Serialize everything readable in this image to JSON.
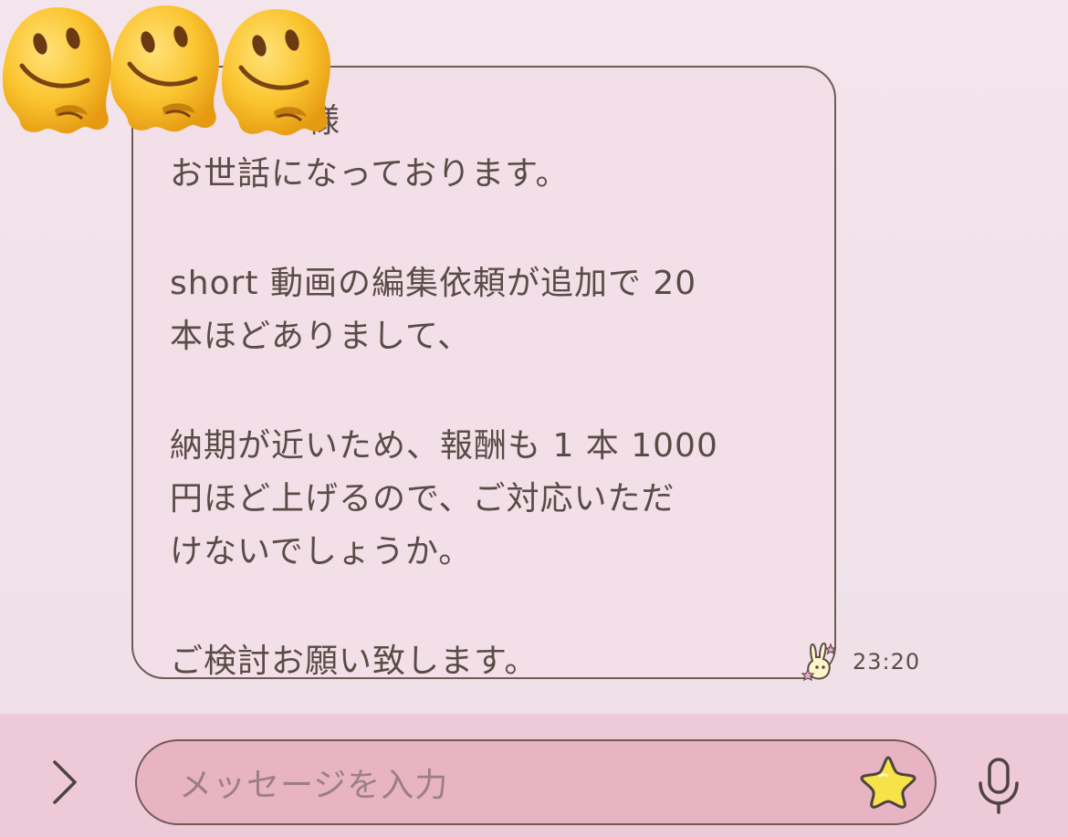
{
  "chat": {
    "message": {
      "lines": [
        "様",
        "お世話になっております。",
        "",
        "short 動画の編集依頼が追加で 20",
        "本ほどありまして、",
        "",
        "納期が近いため、報酬も 1 本 1000",
        "円ほど上げるので、ご対応いただ",
        "けないでしょうか。",
        "",
        "ご検討お願い致します。"
      ],
      "timestamp": "23:20"
    },
    "emoji_overlay": [
      "melting-face-emoji",
      "melting-face-emoji",
      "melting-face-emoji"
    ]
  },
  "input_bar": {
    "placeholder": "メッセージを入力",
    "expand_icon": "chevron-right-icon",
    "emoji_icon": "star-sticker-icon",
    "mic_icon": "microphone-icon"
  },
  "colors": {
    "background": "#f4e4ec",
    "bubble": "#f3dfe8",
    "bubble_border": "#6e5c55",
    "text": "#5b4b46",
    "input_bar": "#eec9d8",
    "input_field": "#e8b3c3"
  }
}
